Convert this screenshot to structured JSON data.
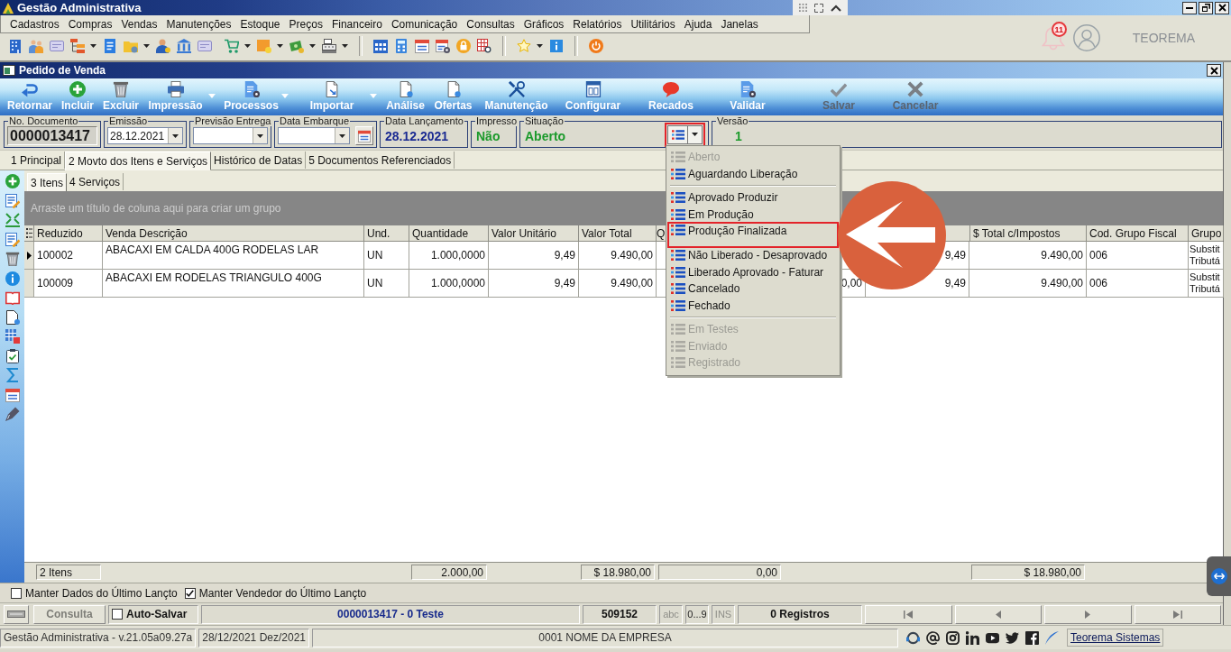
{
  "app": {
    "title": "Gestão Administrativa",
    "notifications": "11",
    "user": "TEOREMA"
  },
  "menu_bar": [
    "Cadastros",
    "Compras",
    "Vendas",
    "Manutenções",
    "Estoque",
    "Preços",
    "Financeiro",
    "Comunicação",
    "Consultas",
    "Gráficos",
    "Relatórios",
    "Utilitários",
    "Ajuda",
    "Janelas"
  ],
  "window": {
    "title": "Pedido de Venda"
  },
  "toolbar": [
    {
      "label": "Retornar",
      "disabled": false,
      "dropdown": false
    },
    {
      "label": "Incluir",
      "disabled": false,
      "dropdown": false
    },
    {
      "label": "Excluir",
      "disabled": false,
      "dropdown": false
    },
    {
      "label": "Impressão",
      "disabled": false,
      "dropdown": true
    },
    {
      "label": "Processos",
      "disabled": false,
      "dropdown": true
    },
    {
      "label": "Importar",
      "disabled": false,
      "dropdown": true
    },
    {
      "label": "Análise",
      "disabled": false,
      "dropdown": false
    },
    {
      "label": "Ofertas",
      "disabled": false,
      "dropdown": false
    },
    {
      "label": "Manutenção",
      "disabled": false,
      "dropdown": false
    },
    {
      "label": "Configurar",
      "disabled": false,
      "dropdown": false
    },
    {
      "label": "Recados",
      "disabled": false,
      "dropdown": false
    },
    {
      "label": "Validar",
      "disabled": false,
      "dropdown": false
    },
    {
      "label": "Salvar",
      "disabled": true,
      "dropdown": false
    },
    {
      "label": "Cancelar",
      "disabled": true,
      "dropdown": false
    }
  ],
  "fields": [
    {
      "kind": "code",
      "label": "No. Documento",
      "value": "0000013417"
    },
    {
      "kind": "dropdown",
      "label": "Emissão",
      "value": "28.12.2021"
    },
    {
      "kind": "dropdown",
      "label": "Previsão Entrega"
    },
    {
      "kind": "dropdown-calendar",
      "label": "Data Embarque"
    },
    {
      "kind": "date",
      "label": "Data Lançamento",
      "value": "28.12.2021"
    },
    {
      "kind": "flag",
      "label": "Impresso",
      "value": "Não"
    },
    {
      "kind": "status",
      "label": "Situação",
      "value": "Aberto",
      "highlighted": true
    },
    {
      "kind": "version",
      "label": "Versão",
      "value": "1"
    }
  ],
  "tabs": [
    {
      "label": "1 Principal",
      "selected": false
    },
    {
      "label": "2 Movto dos Itens e Serviços",
      "selected": true
    },
    {
      "label": "Histórico de Datas",
      "selected": false
    },
    {
      "label": "5 Documentos Referenciados",
      "selected": false
    }
  ],
  "subtabs": [
    {
      "label": "3 Itens",
      "selected": true
    },
    {
      "label": "4 Serviços",
      "selected": false
    }
  ],
  "grid": {
    "group_hint": "Arraste um título de coluna aqui para criar um grupo",
    "columns": [
      {
        "label": "Reduzido"
      },
      {
        "label": "Venda Descrição"
      },
      {
        "label": "Und."
      },
      {
        "label": "Quantidade"
      },
      {
        "label": "Valor Unitário"
      },
      {
        "label": "Valor Total"
      },
      {
        "label": "Q"
      },
      {},
      {},
      {
        "label": "$ Total c/Impostos"
      },
      {
        "label": "Cod. Grupo Fiscal"
      },
      {
        "label": "Grupo"
      }
    ],
    "rows": [
      {
        "kind": "item",
        "selected": true,
        "cells": [
          "100002",
          "ABACAXI EM CALDA 400G RODELAS LAR",
          "UN",
          "1.000,0000",
          "9,49",
          "9.490,00",
          null,
          null,
          "9,49",
          "9.490,00",
          "006",
          "Substit\nTributá"
        ]
      },
      {
        "kind": "item",
        "selected": false,
        "cells": [
          "100009",
          "ABACAXI EM RODELAS TRIANGULO 400G",
          "UN",
          "1.000,0000",
          "9,49",
          "9.490,00",
          null,
          "0,00",
          "9,49",
          "9.490,00",
          "006",
          "Substit\nTributá"
        ]
      },
      {
        "kind": "total",
        "cells": [
          "2 Itens",
          null,
          null,
          "2.000,00",
          null,
          "$ 18.980,00",
          "0,00",
          null,
          null,
          "$ 18.980,00",
          null,
          null
        ]
      }
    ]
  },
  "status_menu": {
    "sections": [
      [
        {
          "label": "Aberto",
          "disabled": true,
          "highlighted": false
        },
        {
          "label": "Aguardando Liberação",
          "disabled": false,
          "highlighted": false
        }
      ],
      [
        {
          "label": "Aprovado Produzir",
          "disabled": false,
          "highlighted": false
        },
        {
          "label": "Em Produção",
          "disabled": false,
          "highlighted": false
        },
        {
          "label": "Produção Finalizada",
          "disabled": false,
          "highlighted": true
        },
        {
          "label": "Não Liberado - Desaprovado",
          "disabled": false,
          "highlighted": false
        },
        {
          "label": "Liberado Aprovado - Faturar",
          "disabled": false,
          "highlighted": false
        },
        {
          "label": "Cancelado",
          "disabled": false,
          "highlighted": false
        },
        {
          "label": "Fechado",
          "disabled": false,
          "highlighted": false
        }
      ],
      [
        {
          "label": "Em Testes",
          "disabled": true,
          "highlighted": false
        },
        {
          "label": "Enviado",
          "disabled": true,
          "highlighted": false
        },
        {
          "label": "Registrado",
          "disabled": true,
          "highlighted": false
        }
      ]
    ]
  },
  "options": [
    {
      "label": "Manter Dados do Último Lançto",
      "checked": false
    },
    {
      "label": "Manter Vendedor do Último Lançto",
      "checked": true
    }
  ],
  "status_bar": {
    "mode": {
      "label": "Consulta",
      "disabled": true
    },
    "auto_save": {
      "label": "Auto-Salvar",
      "checked": false
    },
    "record": "0000013417 - 0 Teste",
    "code": "509152",
    "indicators": [
      {
        "label": "abc",
        "active": false
      },
      {
        "label": "0...9",
        "active": true
      },
      {
        "label": "INS",
        "active": false
      }
    ],
    "count": "0 Registros"
  },
  "footer": {
    "version": "Gestão Administrativa - v.21.05a09.27a",
    "period": "28/12/2021 Dez/2021",
    "company": "0001 NOME DA EMPRESA",
    "link": "Teorema Sistemas"
  }
}
